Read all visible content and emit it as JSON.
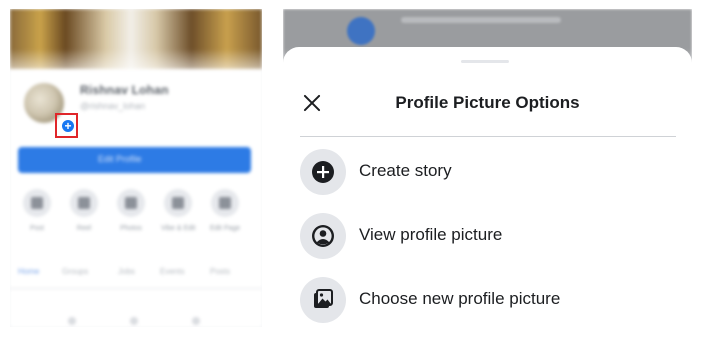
{
  "left_panel": {
    "profile_name": "Rishnav Lohan",
    "profile_handle": "@rishnav_lohan",
    "edit_button_label": "Edit Profile",
    "actions": [
      "Post",
      "Reel",
      "Photos",
      "Vibe & Edit",
      "Edit Page"
    ],
    "tabs": [
      "Home",
      "Groups",
      "Jobs",
      "Events",
      "Posts"
    ],
    "plus_badge": "+"
  },
  "sheet": {
    "title": "Profile Picture Options",
    "options": [
      {
        "label": "Create story",
        "icon": "plus-circle-icon"
      },
      {
        "label": "View profile picture",
        "icon": "user-circle-icon"
      },
      {
        "label": "Choose new profile picture",
        "icon": "image-gallery-icon"
      }
    ]
  },
  "colors": {
    "accent": "#1877f2",
    "highlight": "#e0262a",
    "icon_bg": "#e4e6ea",
    "text": "#1c1e21"
  }
}
